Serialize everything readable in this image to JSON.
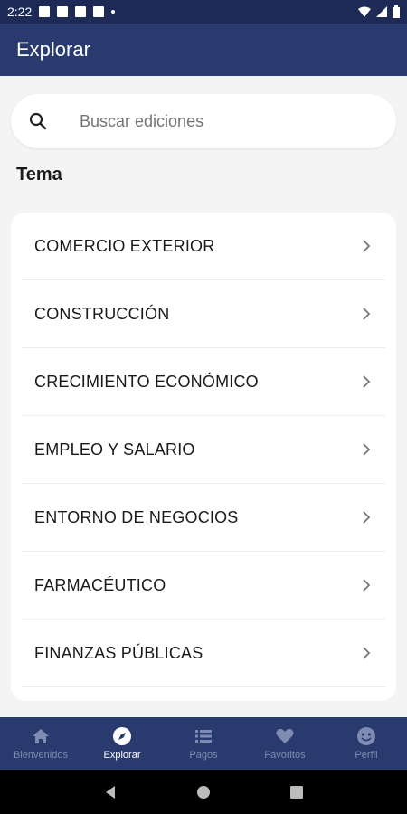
{
  "status_bar": {
    "time": "2:22"
  },
  "app_bar": {
    "title": "Explorar"
  },
  "search": {
    "placeholder": "Buscar ediciones"
  },
  "section": {
    "title": "Tema"
  },
  "topics": [
    {
      "label": "COMERCIO EXTERIOR"
    },
    {
      "label": "CONSTRUCCIÓN"
    },
    {
      "label": "CRECIMIENTO ECONÓMICO"
    },
    {
      "label": "EMPLEO Y SALARIO"
    },
    {
      "label": "ENTORNO DE NEGOCIOS"
    },
    {
      "label": "FARMACÉUTICO"
    },
    {
      "label": "FINANZAS PÚBLICAS"
    }
  ],
  "bottom_nav": [
    {
      "label": "Bienvenidos",
      "icon": "home-icon",
      "active": false
    },
    {
      "label": "Explorar",
      "icon": "compass-icon",
      "active": true
    },
    {
      "label": "Pagos",
      "icon": "list-icon",
      "active": false
    },
    {
      "label": "Favoritos",
      "icon": "heart-icon",
      "active": false
    },
    {
      "label": "Perfil",
      "icon": "profile-icon",
      "active": false
    }
  ],
  "colors": {
    "primary": "#283a6e",
    "status_bar": "#1c2a55",
    "inactive_nav": "#7f8bb0",
    "background": "#f4f4f4"
  }
}
